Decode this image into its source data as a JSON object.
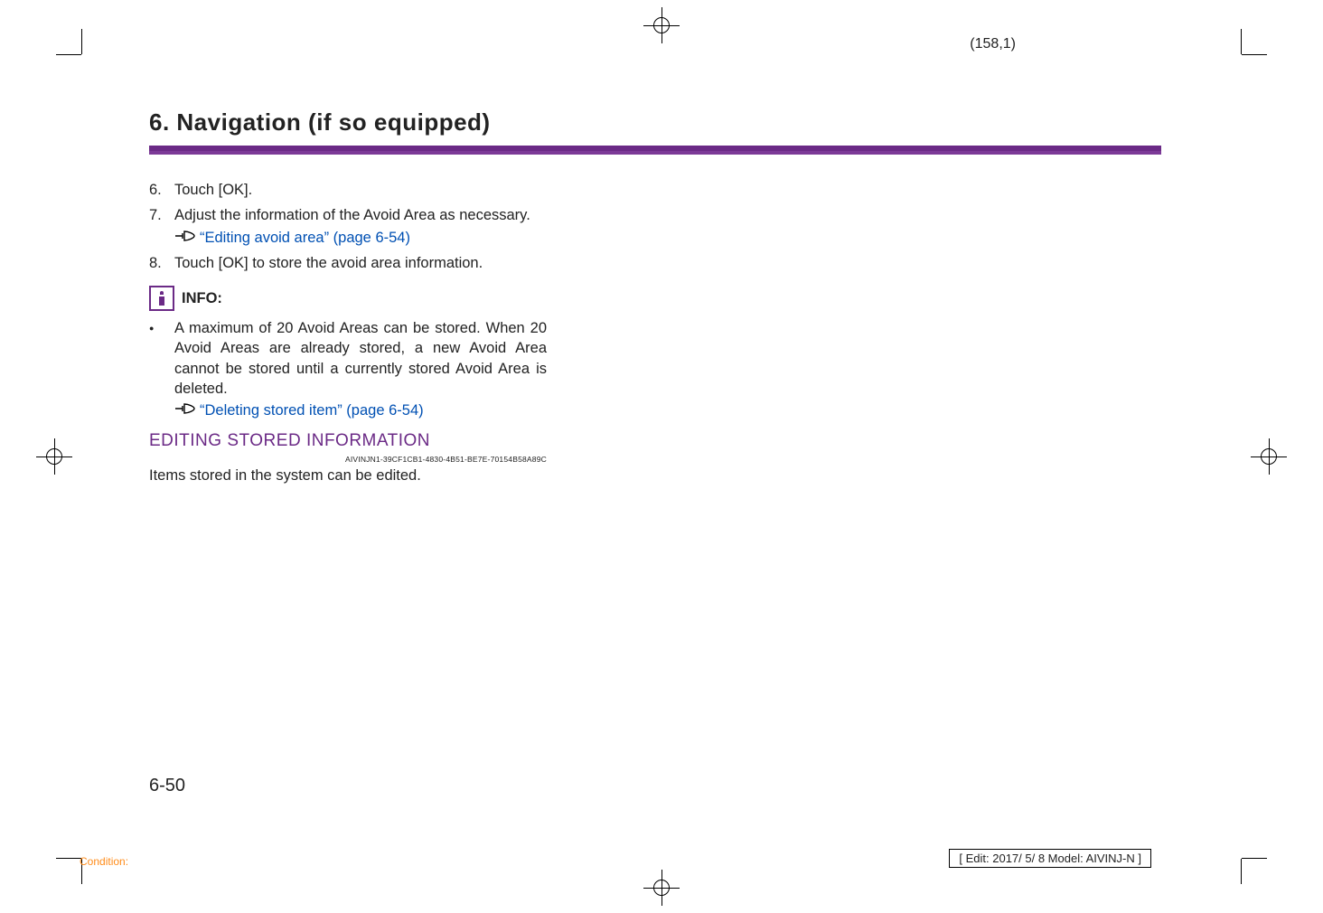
{
  "sheet_number": "(158,1)",
  "heading": "6. Navigation (if so equipped)",
  "steps": [
    {
      "num": "6.",
      "text": "Touch [OK]."
    },
    {
      "num": "7.",
      "text": "Adjust the information of the Avoid Area as necessary.",
      "xref": "“Editing avoid area” (page 6-54)"
    },
    {
      "num": "8.",
      "text": "Touch [OK] to store the avoid area information."
    }
  ],
  "info_label": "INFO:",
  "bullet": {
    "text": "A maximum of 20 Avoid Areas can be stored. When 20 Avoid Areas are already stored, a new Avoid Area cannot be stored until a currently stored Avoid Area is deleted.",
    "xref": "“Deleting stored item” (page 6-54)"
  },
  "section_heading": "EDITING STORED INFORMATION",
  "section_id": "AIVINJN1-39CF1CB1-4830-4B51-BE7E-70154B58A89C",
  "section_para": "Items stored in the system can be edited.",
  "page_num": "6-50",
  "condition": "Condition:",
  "edit_box": "[ Edit: 2017/ 5/ 8   Model: AIVINJ-N ]"
}
